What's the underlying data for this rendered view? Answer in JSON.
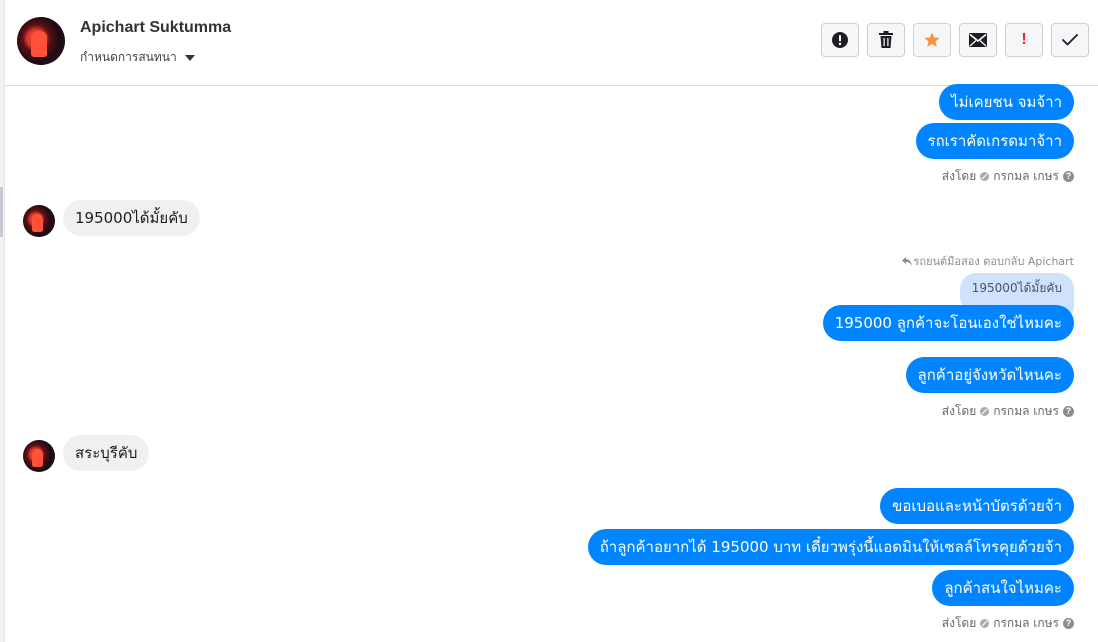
{
  "header": {
    "contact_name": "Apichart Suktumma",
    "subtitle": "กำหนดการสนทนา",
    "toolbar": [
      {
        "name": "spam-button",
        "icon": "alert-circle-icon"
      },
      {
        "name": "delete-button",
        "icon": "trash-icon"
      },
      {
        "name": "star-button",
        "icon": "star-icon",
        "color": "#f7923a"
      },
      {
        "name": "mark-unread-button",
        "icon": "envelope-icon"
      },
      {
        "name": "important-button",
        "icon": "exclamation-icon",
        "label": "!",
        "color": "#e0243b"
      },
      {
        "name": "mark-done-button",
        "icon": "check-icon"
      }
    ]
  },
  "messages": {
    "m1": "ไม่เคยชน จมจ้าา",
    "m2": "รถเราคัดเกรดมาจ้าา",
    "sent_by_1": "ส่งโดย",
    "sender_1": "กรกมล เกษร",
    "m3": "195000ได้มั้ยคับ",
    "reply_label": "รถยนต์มือสอง ตอบกลับ Apichart",
    "reply_quote": "195000ได้มั้ยคับ",
    "m4": "195000 ลูกค้าจะโอนเองใช่ไหมคะ",
    "m5": "ลูกค้าอยู่จังหวัดไหนคะ",
    "sent_by_2": "ส่งโดย",
    "sender_2": "กรกมล เกษร",
    "m6": "สระบุรีคับ",
    "m7": "ขอเบอและหน้าบัตรด้วยจ้า",
    "m8": "ถ้าลูกค้าอยากได้ 195000 บาท เดี๋ยวพรุ่งนี้แอดมินให้เซลล์โทรคุยด้วยจ้า",
    "m9": "ลูกค้าสนใจไหมคะ",
    "sent_by_3": "ส่งโดย",
    "sender_3": "กรกมล เกษร"
  },
  "colors": {
    "outgoing_bubble": "#0084ff",
    "incoming_bubble": "#f0f0f0",
    "reply_quote_bg": "#cfe2fb"
  }
}
